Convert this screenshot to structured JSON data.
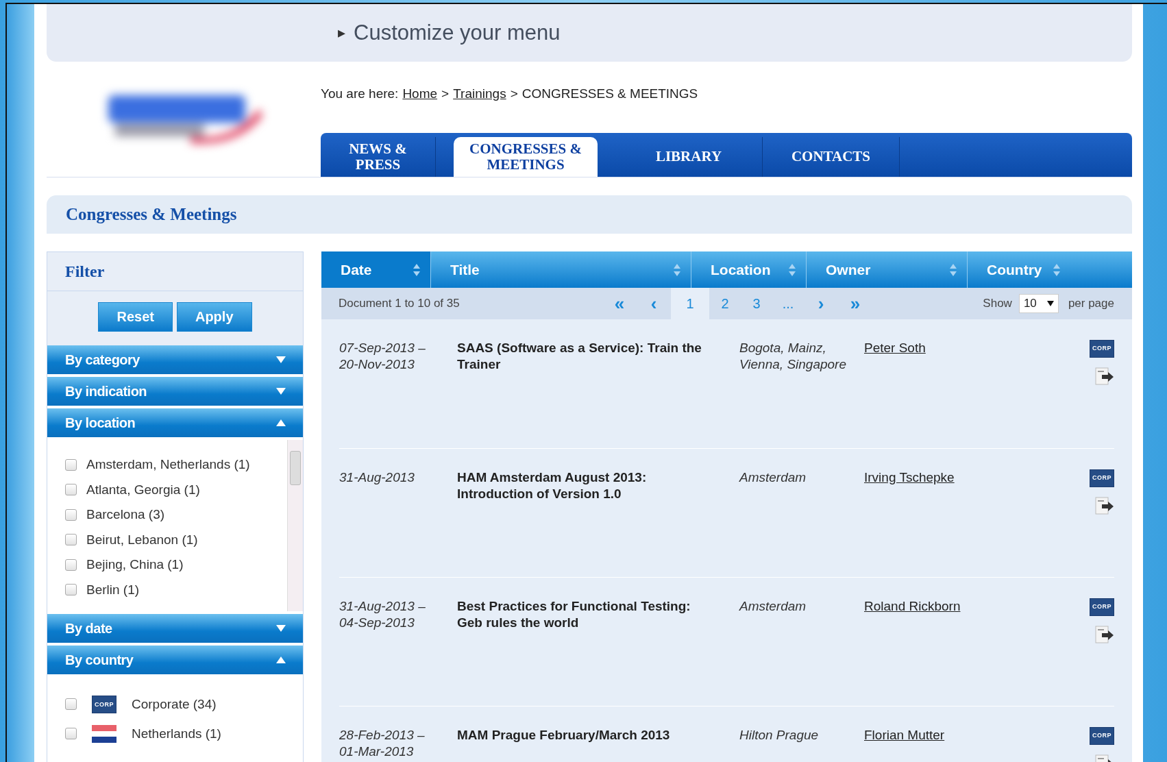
{
  "banner": {
    "marker": "▸",
    "title": "Customize your menu"
  },
  "breadcrumb": {
    "prefix": "You are here:",
    "links": [
      "Home",
      "Trainings"
    ],
    "separator": ">",
    "current": "CONGRESSES & MEETINGS"
  },
  "tabs": [
    {
      "label": "NEWS &\nPRESS",
      "selected": false
    },
    {
      "label": "CONGRESSES &\nMEETINGS",
      "selected": true
    },
    {
      "label": "LIBRARY",
      "selected": false
    },
    {
      "label": "CONTACTS",
      "selected": false
    }
  ],
  "section_title": "Congresses & Meetings",
  "filter": {
    "title": "Filter",
    "buttons": [
      "Reset",
      "Apply"
    ],
    "groups": [
      {
        "label": "By category",
        "expanded": false
      },
      {
        "label": "By indication",
        "expanded": false
      },
      {
        "label": "By location",
        "expanded": true,
        "kind": "scroll",
        "items": [
          {
            "label": "Amsterdam, Netherlands (1)",
            "checked": false
          },
          {
            "label": "Atlanta, Georgia (1)",
            "checked": false
          },
          {
            "label": "Barcelona (3)",
            "checked": false
          },
          {
            "label": "Beirut, Lebanon (1)",
            "checked": false
          },
          {
            "label": "Bejing, China (1)",
            "checked": false
          },
          {
            "label": "Berlin (1)",
            "checked": false
          }
        ]
      },
      {
        "label": "By date",
        "expanded": false
      },
      {
        "label": "By country",
        "expanded": true,
        "kind": "flags",
        "items": [
          {
            "label": "Corporate (34)",
            "checked": false,
            "kind": "corp",
            "badge": "CORP"
          },
          {
            "label": "Netherlands (1)",
            "checked": false,
            "kind": "flag"
          }
        ]
      }
    ]
  },
  "table": {
    "columns": [
      "Date",
      "Title",
      "Location",
      "Owner",
      "Country"
    ],
    "pager": {
      "summary": "Document 1 to 10 of 35",
      "first": "«",
      "prev": "‹",
      "pages": [
        {
          "label": "1",
          "selected": true
        },
        {
          "label": "2",
          "selected": false
        },
        {
          "label": "3",
          "selected": false
        },
        {
          "label": "...",
          "selected": false
        }
      ],
      "next": "›",
      "last": "»",
      "show": "Show",
      "page_size": "10",
      "per_page": "per page"
    },
    "rows": [
      {
        "start": "07-Sep-2013 –",
        "end": "20-Nov-2013",
        "title": "SAAS (Software as a Service): Train the Trainer",
        "location": "Bogota, Mainz, Vienna, Singapore",
        "owner": "Peter Soth",
        "badge": "CORP"
      },
      {
        "start": "31-Aug-2013",
        "title": "HAM Amsterdam August 2013: Introduction of Version 1.0",
        "location": "Amsterdam",
        "owner": "Irving Tschepke",
        "badge": "CORP"
      },
      {
        "start": "31-Aug-2013 –",
        "end": "04-Sep-2013",
        "title": "Best Practices for Functional Testing: Geb rules the world",
        "location": "Amsterdam",
        "owner": "Roland Rickborn",
        "badge": "CORP"
      },
      {
        "start": "28-Feb-2013 –",
        "end": "01-Mar-2013",
        "title": "MAM Prague February/March 2013",
        "location": "Hilton Prague",
        "owner": "Florian Mutter",
        "badge": "CORP"
      }
    ]
  }
}
